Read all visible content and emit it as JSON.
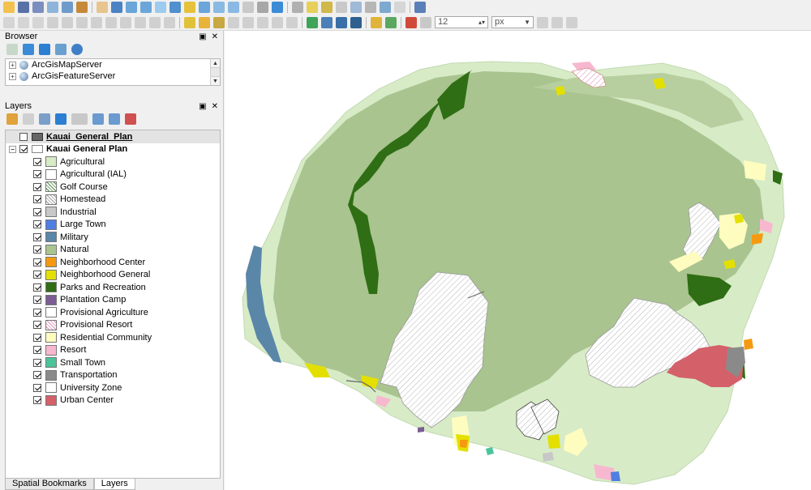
{
  "toolbar": {
    "font_size_value": "12",
    "unit_value": "px"
  },
  "browser": {
    "title": "Browser",
    "items": [
      {
        "label": "ArcGisMapServer",
        "expander": "+"
      },
      {
        "label": "ArcGisFeatureServer",
        "expander": "+"
      }
    ]
  },
  "layers": {
    "title": "Layers",
    "groups": [
      {
        "label": "Kauai_General_Plan",
        "checked": false
      },
      {
        "label": "Kauai General Plan",
        "checked": true
      }
    ],
    "classes": [
      {
        "label": "Agricultural",
        "color": "#d7ebc7"
      },
      {
        "label": "Agricultural (IAL)",
        "color": "#ffffff"
      },
      {
        "label": "Golf Course",
        "color": "#ffffff",
        "pattern": "green-hatch"
      },
      {
        "label": "Homestead",
        "color": "#ffffff",
        "pattern": "grey-hatch"
      },
      {
        "label": "Industrial",
        "color": "#c8c8c8"
      },
      {
        "label": "Large Town",
        "color": "#4f7fe0"
      },
      {
        "label": "Military",
        "color": "#5a86a8"
      },
      {
        "label": "Natural",
        "color": "#a9c48f"
      },
      {
        "label": "Neighborhood Center",
        "color": "#f59a10"
      },
      {
        "label": "Neighborhood General",
        "color": "#e3e000"
      },
      {
        "label": "Parks and Recreation",
        "color": "#2f6e14"
      },
      {
        "label": "Plantation Camp",
        "color": "#7b5d93"
      },
      {
        "label": "Provisional Agriculture",
        "color": "#ffffff"
      },
      {
        "label": "Provisional Resort",
        "color": "#ffffff",
        "pattern": "pink-hatch"
      },
      {
        "label": "Residential Community",
        "color": "#fffcc0"
      },
      {
        "label": "Resort",
        "color": "#f7b8cf"
      },
      {
        "label": "Small Town",
        "color": "#4cc49a"
      },
      {
        "label": "Transportation",
        "color": "#8a8a8a"
      },
      {
        "label": "University Zone",
        "color": "#ffffff"
      },
      {
        "label": "Urban Center",
        "color": "#d4606a"
      }
    ]
  },
  "tabs": {
    "spatial_bookmarks": "Spatial Bookmarks",
    "layers": "Layers"
  }
}
